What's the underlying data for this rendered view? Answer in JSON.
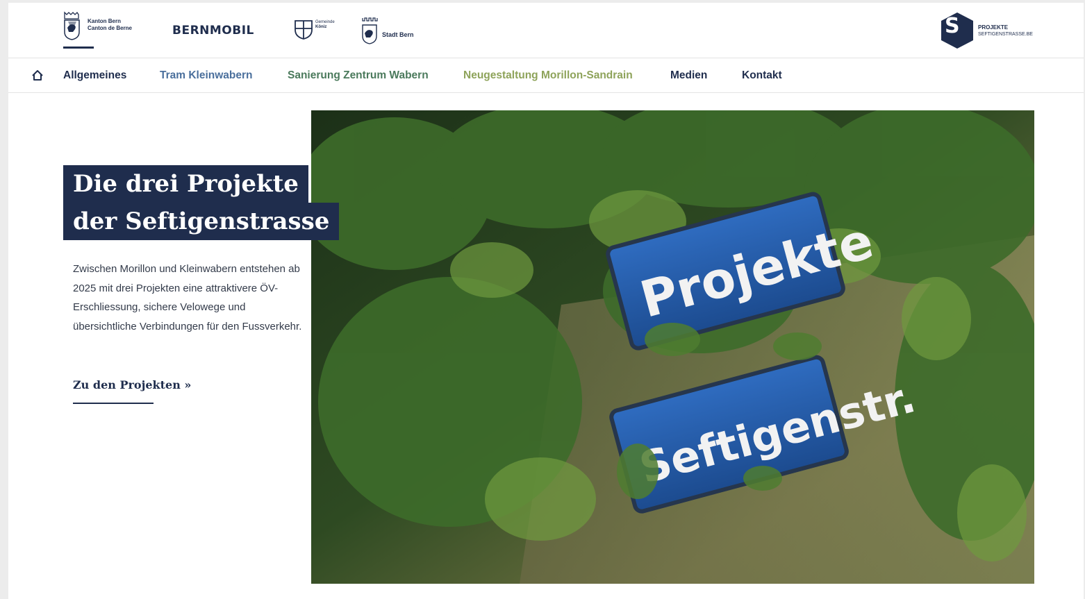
{
  "header": {
    "logos": [
      {
        "name": "kanton-bern",
        "lines": [
          "Kanton Bern",
          "Canton de Berne"
        ]
      },
      {
        "name": "bernmobil",
        "text": "BERNMOBIL"
      },
      {
        "name": "gemeinde-koeniz",
        "lines": [
          "Gemeinde",
          "Köniz"
        ]
      },
      {
        "name": "stadt-bern",
        "text": "Stadt Bern"
      },
      {
        "name": "projekte-seftigenstrasse",
        "lines": [
          "PROJEKTE",
          "SEFTIGENSTRASSE.BE"
        ]
      }
    ]
  },
  "nav": {
    "home_icon": "home-icon",
    "items": [
      {
        "label": "Allgemeines",
        "color": "#1f2d4d"
      },
      {
        "label": "Tram Kleinwabern",
        "color": "#4a6f9c"
      },
      {
        "label": "Sanierung Zentrum Wabern",
        "color": "#4b7a5c"
      },
      {
        "label": "Neugestaltung Morillon-Sandrain",
        "color": "#8ea35a"
      },
      {
        "label": "Medien",
        "color": "#1f2d4d"
      },
      {
        "label": "Kontakt",
        "color": "#1f2d4d"
      }
    ]
  },
  "hero": {
    "title_line1": "Die drei Projekte",
    "title_line2": "der Seftigenstrasse",
    "intro": "Zwischen Morillon und Kleinwabern entstehen ab 2025 mit drei Projekten eine attraktivere ÖV-Erschliessung, sichere Velowege und übersichtliche Verbindungen für den Fussverkehr.",
    "cta": "Zu den Projekten »",
    "image_signs": [
      "Projekte",
      "Seftigenstr."
    ]
  },
  "colors": {
    "brand": "#1f2d4d",
    "background": "#ffffff"
  }
}
